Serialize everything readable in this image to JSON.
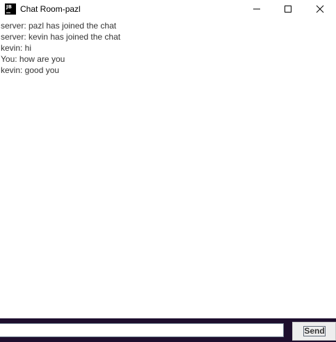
{
  "window": {
    "title": "Chat Room-pazl",
    "app_icon": "JB"
  },
  "titlebar_controls": {
    "minimize": "minimize-icon",
    "maximize": "maximize-icon",
    "close": "close-icon"
  },
  "messages": [
    "server: pazl has joined the chat",
    "server: kevin has joined the chat",
    "kevin: hi",
    "You: how are you",
    "kevin: good you"
  ],
  "composer": {
    "input_value": "",
    "send_label": "Send"
  },
  "colors": {
    "bottom_bar": "#1e0f2e",
    "text": "#333333"
  }
}
